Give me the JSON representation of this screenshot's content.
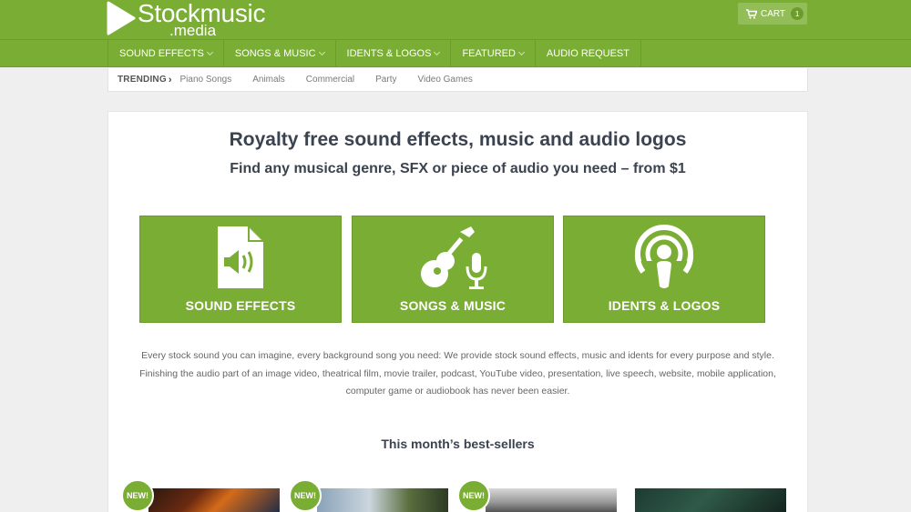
{
  "brand": {
    "name": "Stockmusic",
    "sub": ".media"
  },
  "cart": {
    "label": "CART",
    "count": "1"
  },
  "nav": [
    {
      "label": "SOUND EFFECTS",
      "dropdown": true
    },
    {
      "label": "SONGS & MUSIC",
      "dropdown": true
    },
    {
      "label": "IDENTS & LOGOS",
      "dropdown": true
    },
    {
      "label": "FEATURED",
      "dropdown": true
    },
    {
      "label": "AUDIO REQUEST",
      "dropdown": false
    }
  ],
  "trending": {
    "label": "TRENDING",
    "links": [
      "Piano Songs",
      "Animals",
      "Commercial",
      "Party",
      "Video Games"
    ]
  },
  "hero": {
    "title": "Royalty free sound effects, music and audio logos",
    "subtitle": "Find any musical genre, SFX or piece of audio you need – from $1"
  },
  "categories": [
    {
      "label": "SOUND EFFECTS",
      "icon": "audio-file-icon"
    },
    {
      "label": "SONGS & MUSIC",
      "icon": "guitar-microphone-icon"
    },
    {
      "label": "IDENTS & LOGOS",
      "icon": "podcast-icon"
    }
  ],
  "description": "Every stock sound you can imagine, every background song you need: We provide stock sound effects, music and idents for every purpose and style. Finishing the audio part of an image video, theatrical film, movie trailer, podcast, YouTube video, presentation, live speech, website, mobile application, computer game or audiobook has never been easier.",
  "bestsellers": {
    "title": "This month’s best-sellers",
    "badge": "NEW!",
    "items": [
      {
        "badge": true
      },
      {
        "badge": true
      },
      {
        "badge": true
      },
      {
        "badge": false
      }
    ]
  },
  "colors": {
    "brand_green": "#7aad33",
    "background": "#efefef"
  }
}
